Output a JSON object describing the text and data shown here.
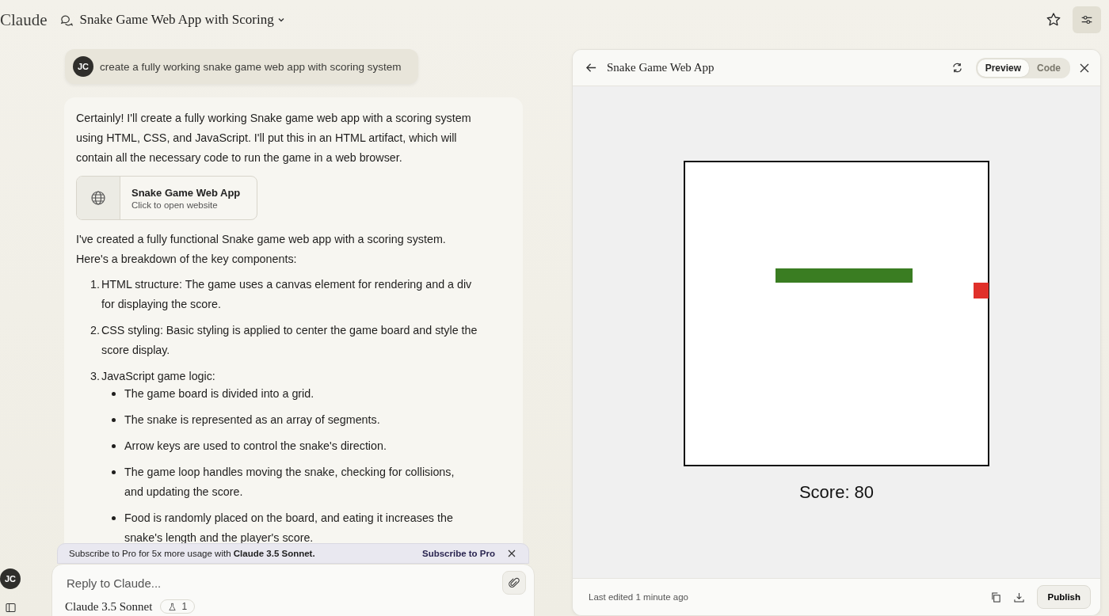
{
  "app_name": "Claude",
  "conversation": {
    "title": "Snake Game Web App with Scoring"
  },
  "user_message": {
    "initials": "JC",
    "text": "create a fully working snake game web app with scoring system"
  },
  "response": {
    "intro": "Certainly! I'll create a fully working Snake game web app with a scoring system using HTML, CSS, and JavaScript. I'll put this in an HTML artifact, which will contain all the necessary code to run the game in a web browser.",
    "artifact": {
      "title": "Snake Game Web App",
      "subtitle": "Click to open website"
    },
    "summary": "I've created a fully functional Snake game web app with a scoring system. Here's a breakdown of the key components:",
    "steps": [
      {
        "number": "1.",
        "text": "HTML structure: The game uses a canvas element for rendering and a div for displaying the score."
      },
      {
        "number": "2.",
        "text": "CSS styling: Basic styling is applied to center the game board and style the score display."
      },
      {
        "number": "3.",
        "text": "JavaScript game logic:",
        "children": [
          {
            "text": "The game board is divided into a grid."
          },
          {
            "text": "The snake is represented as an array of segments."
          },
          {
            "text": "Arrow keys are used to control the snake's direction."
          },
          {
            "text": "The game loop handles moving the snake, checking for collisions, and updating the score."
          },
          {
            "text": "Food is randomly placed on the board, and eating it increases the snake's length and the player's score."
          }
        ]
      }
    ]
  },
  "banner": {
    "text": "Subscribe to Pro for 5x more usage with **Claude 3.5 Sonnet.**",
    "link": "Subscribe to Pro"
  },
  "composer": {
    "placeholder": "Reply to Claude...",
    "model": "Claude 3.5 Sonnet",
    "badge": "1"
  },
  "sidebar_user": {
    "initials": "JC"
  },
  "artifact_panel": {
    "title": "Snake Game Web App",
    "tabs": [
      {
        "label": "Preview",
        "selected": true
      },
      {
        "label": "Code",
        "selected": false
      }
    ],
    "score": "Score: 80",
    "footer": {
      "status": "Last edited 1 minute ago",
      "publish": "Publish"
    }
  }
}
